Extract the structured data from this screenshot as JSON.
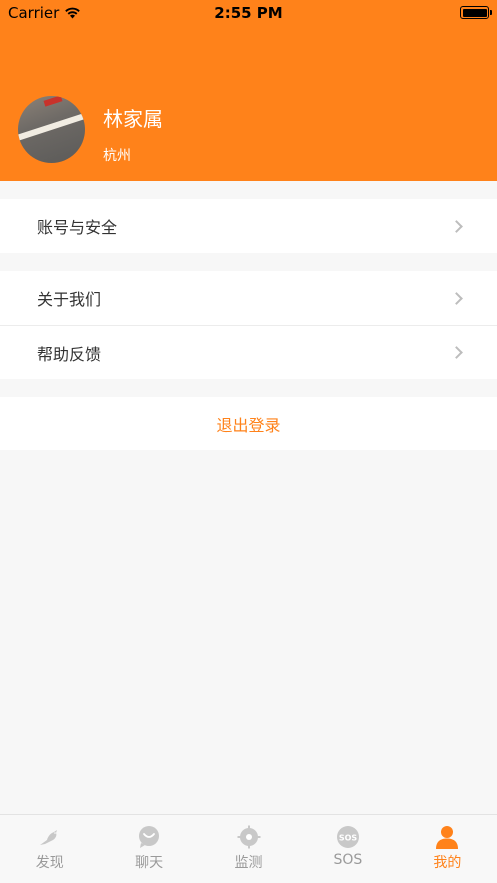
{
  "status_bar": {
    "carrier": "Carrier",
    "time": "2:55 PM"
  },
  "profile": {
    "name": "林家属",
    "city": "杭州"
  },
  "menu": {
    "account_security": "账号与安全",
    "about_us": "关于我们",
    "help_feedback": "帮助反馈",
    "logout": "退出登录"
  },
  "tabs": [
    {
      "label": "发现",
      "icon": "bird-icon",
      "active": false
    },
    {
      "label": "聊天",
      "icon": "chat-icon",
      "active": false
    },
    {
      "label": "监测",
      "icon": "monitor-icon",
      "active": false
    },
    {
      "label": "SOS",
      "icon": "sos-icon",
      "active": false
    },
    {
      "label": "我的",
      "icon": "person-icon",
      "active": true
    }
  ],
  "colors": {
    "accent": "#ff821a",
    "inactive": "#c8c8c8"
  }
}
